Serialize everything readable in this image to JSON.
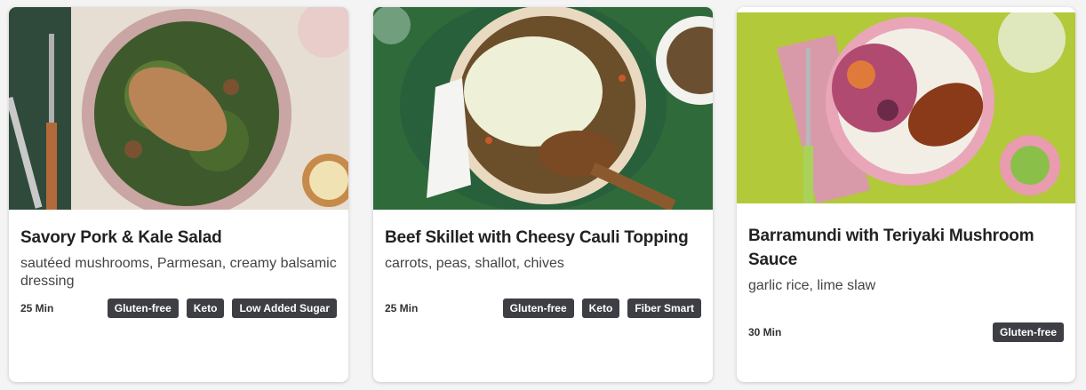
{
  "cards": [
    {
      "title": "Savory Pork & Kale Salad",
      "description": "sautéed mushrooms, Parmesan, creamy balsamic dressing",
      "time": "25 Min",
      "tags": [
        "Gluten-free",
        "Keto",
        "Low Added Sugar"
      ]
    },
    {
      "title": "Beef Skillet with Cheesy Cauli Topping",
      "description": "carrots, peas, shallot, chives",
      "time": "25 Min",
      "tags": [
        "Gluten-free",
        "Keto",
        "Fiber Smart"
      ]
    },
    {
      "title": "Barramundi with Teriyaki Mushroom Sauce",
      "description": "garlic rice, lime slaw",
      "time": "30 Min",
      "tags": [
        "Gluten-free"
      ]
    }
  ]
}
